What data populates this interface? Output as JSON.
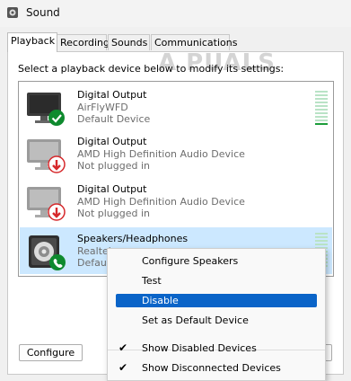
{
  "window": {
    "title": "Sound"
  },
  "tabs": [
    "Playback",
    "Recording",
    "Sounds",
    "Communications"
  ],
  "instruction": "Select a playback device below to modify its settings:",
  "watermark": "A PUALS",
  "devices": [
    {
      "name": "Digital Output",
      "description": "AirFlyWFD",
      "status": "Default Device",
      "badge": "check",
      "level": 0.0
    },
    {
      "name": "Digital Output",
      "description": "AMD High Definition Audio Device",
      "status": "Not plugged in",
      "badge": "unplugged"
    },
    {
      "name": "Digital Output",
      "description": "AMD High Definition Audio Device",
      "status": "Not plugged in",
      "badge": "unplugged"
    },
    {
      "name": "Speakers/Headphones",
      "description": "Realtek",
      "status": "Default",
      "badge": "phone",
      "selected": true
    }
  ],
  "buttons": {
    "configure": "Configure"
  },
  "context_menu": {
    "items": [
      {
        "label": "Configure Speakers"
      },
      {
        "label": "Test"
      },
      {
        "label": "Disable",
        "highlighted": true
      },
      {
        "label": "Set as Default Device"
      },
      {
        "label": "Show Disabled Devices",
        "checked": true
      },
      {
        "label": "Show Disconnected Devices",
        "checked": true
      }
    ]
  },
  "colors": {
    "accent": "#0a64c8",
    "selection": "#cce8ff",
    "meter_on": "#1c9d3a",
    "meter_off": "#b9e3c6",
    "unplug_red": "#d6282b",
    "check_green": "#0e8a2e"
  }
}
